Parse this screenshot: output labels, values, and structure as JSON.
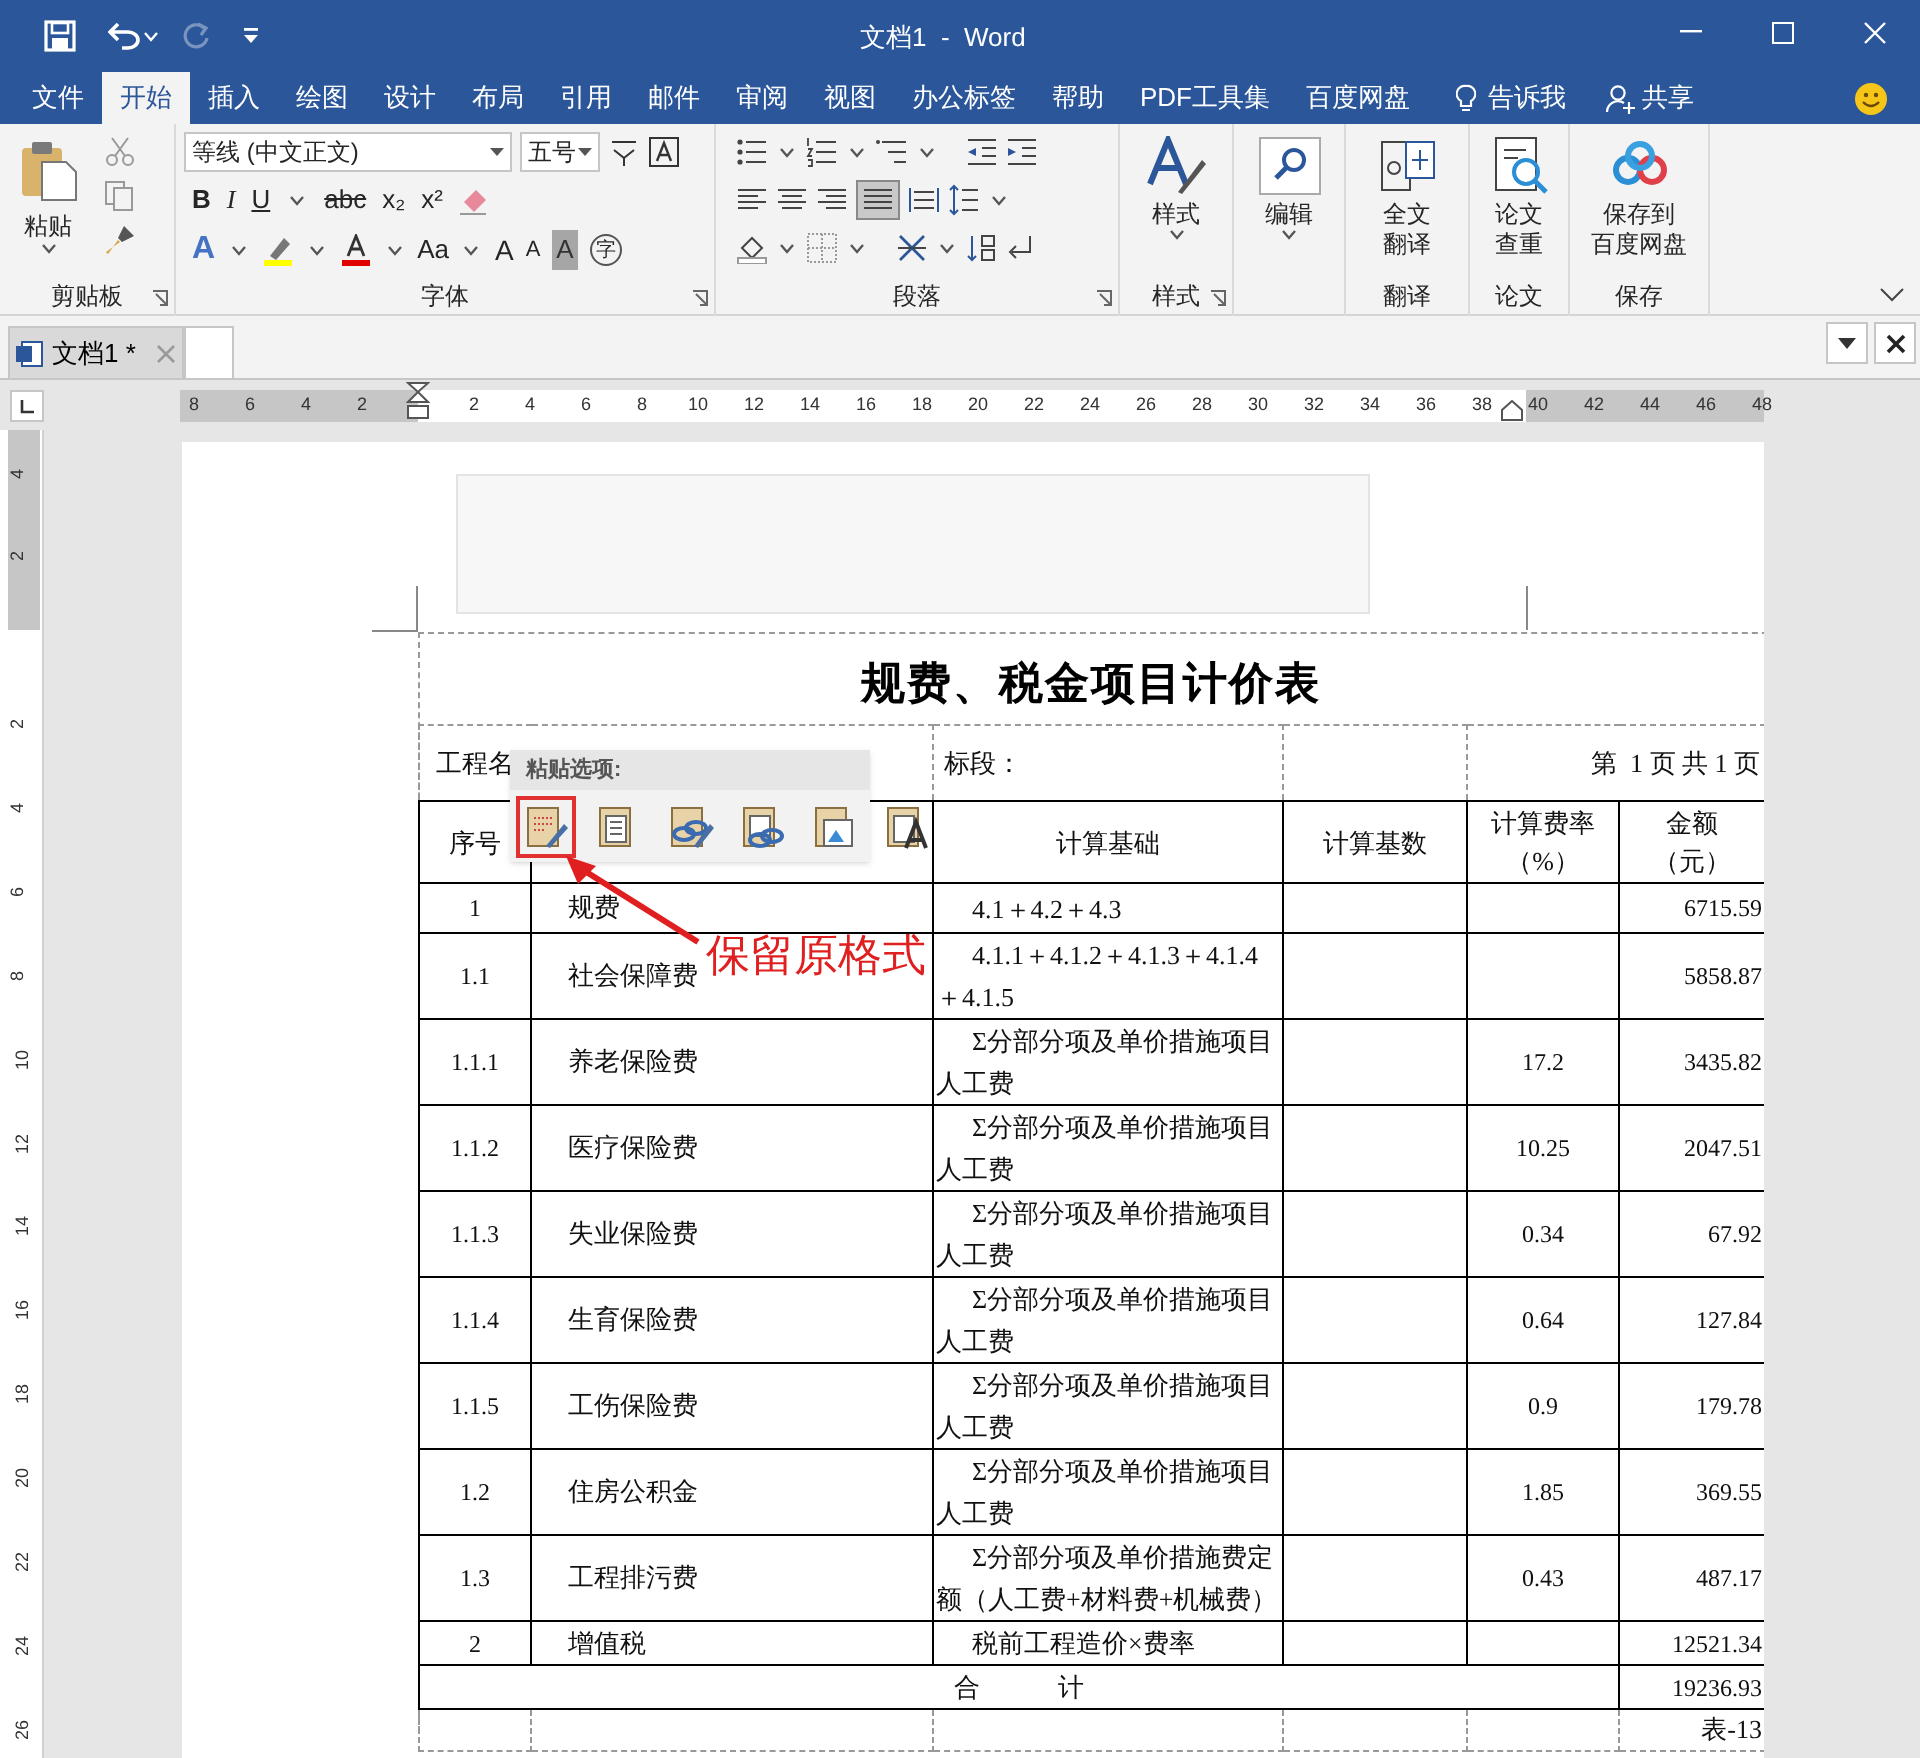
{
  "window": {
    "title": "文档1  -  Word"
  },
  "menu_tabs": [
    {
      "label": "文件",
      "selected": false
    },
    {
      "label": "开始",
      "selected": true
    },
    {
      "label": "插入",
      "selected": false
    },
    {
      "label": "绘图",
      "selected": false
    },
    {
      "label": "设计",
      "selected": false
    },
    {
      "label": "布局",
      "selected": false
    },
    {
      "label": "引用",
      "selected": false
    },
    {
      "label": "邮件",
      "selected": false
    },
    {
      "label": "审阅",
      "selected": false
    },
    {
      "label": "视图",
      "selected": false
    },
    {
      "label": "办公标签",
      "selected": false
    },
    {
      "label": "帮助",
      "selected": false
    },
    {
      "label": "PDF工具集",
      "selected": false
    },
    {
      "label": "百度网盘",
      "selected": false
    }
  ],
  "tell_me": "告诉我",
  "share": "共享",
  "ribbon": {
    "groups": [
      {
        "kind": "clipboard",
        "label": "剪贴板",
        "button": "粘贴"
      },
      {
        "kind": "font",
        "label": "字体",
        "font_name": "等线 (中文正文)",
        "font_size": "五号",
        "row2": [
          "B",
          "I",
          "U",
          "abc",
          "x₂",
          "x²"
        ],
        "row3": [
          "A",
          "Aa",
          "A",
          "A",
          "A",
          "字"
        ]
      },
      {
        "kind": "paragraph",
        "label": "段落"
      },
      {
        "kind": "styles",
        "label": "样式",
        "button": "样式"
      },
      {
        "kind": "editing",
        "button": "编辑"
      },
      {
        "kind": "translate",
        "label": "翻译",
        "button": [
          "全文",
          "翻译"
        ]
      },
      {
        "kind": "paper",
        "label": "论文",
        "button": [
          "论文",
          "查重"
        ]
      },
      {
        "kind": "save",
        "label": "保存",
        "button": [
          "保存到",
          "百度网盘"
        ]
      }
    ]
  },
  "doc_tabs": [
    {
      "label": "文档1 *",
      "selected": true
    }
  ],
  "hruler": [
    "8",
    "6",
    "4",
    "2",
    "2",
    "4",
    "6",
    "8",
    "10",
    "12",
    "14",
    "16",
    "18",
    "20",
    "22",
    "24",
    "26",
    "28",
    "30",
    "32",
    "34",
    "36",
    "38",
    "40",
    "42",
    "44",
    "46",
    "48"
  ],
  "vruler": [
    "4",
    "2",
    "2",
    "4",
    "6",
    "8",
    "10",
    "12",
    "14",
    "16",
    "18",
    "20",
    "22",
    "24",
    "26"
  ],
  "document": {
    "title": "规费、税金项目计价表",
    "info": [
      "工程名",
      "标段：",
      "第  1 页 共 1 页"
    ],
    "columns": [
      {
        "label": "序号"
      },
      {},
      {
        "label": "计算基础"
      },
      {
        "label": "计算基数"
      },
      {
        "label": "计算费率",
        "unit": "（%）"
      },
      {
        "label": "金额",
        "unit": "（元）"
      }
    ],
    "rows": [
      [
        "1",
        "规费",
        "4.1＋4.2＋4.3",
        "",
        "",
        "6715.59"
      ],
      [
        "1.1",
        "社会保障费",
        "4.1.1＋4.1.2＋4.1.3＋4.1.4＋4.1.5",
        "",
        "",
        "5858.87"
      ],
      [
        "1.1.1",
        "养老保险费",
        "Σ分部分项及单价措施项目人工费",
        "",
        "17.2",
        "3435.82"
      ],
      [
        "1.1.2",
        "医疗保险费",
        "Σ分部分项及单价措施项目人工费",
        "",
        "10.25",
        "2047.51"
      ],
      [
        "1.1.3",
        "失业保险费",
        "Σ分部分项及单价措施项目人工费",
        "",
        "0.34",
        "67.92"
      ],
      [
        "1.1.4",
        "生育保险费",
        "Σ分部分项及单价措施项目人工费",
        "",
        "0.64",
        "127.84"
      ],
      [
        "1.1.5",
        "工伤保险费",
        "Σ分部分项及单价措施项目人工费",
        "",
        "0.9",
        "179.78"
      ],
      [
        "1.2",
        "住房公积金",
        "Σ分部分项及单价措施项目人工费",
        "",
        "1.85",
        "369.55"
      ],
      [
        "1.3",
        "工程排污费",
        "Σ分部分项及单价措施费定额（人工费+材料费+机械费）",
        "",
        "0.43",
        "487.17"
      ],
      [
        "2",
        "增值税",
        "税前工程造价×费率",
        "",
        "",
        "12521.34"
      ]
    ],
    "total": {
      "label": "合　　　计",
      "amount": "19236.93"
    },
    "footer": "表-13"
  },
  "paste_popup": {
    "title": "粘贴选项:",
    "options": [
      {
        "selected": true
      },
      {
        "selected": false
      },
      {
        "selected": false
      },
      {
        "selected": false
      },
      {
        "selected": false
      },
      {
        "selected": false
      }
    ]
  },
  "annotation": "保留原格式"
}
